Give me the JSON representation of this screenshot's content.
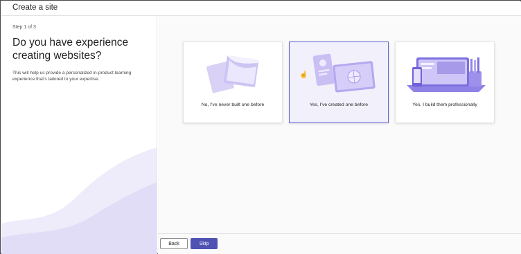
{
  "window": {
    "title": "Create a site"
  },
  "left": {
    "step": "Step 1 of 3",
    "heading": "Do you have experience creating websites?",
    "description": "This will help us provide a personalized in-product learning experience that's tailored to your expertise."
  },
  "options": [
    {
      "label": "No, I've never built one before",
      "selected": false
    },
    {
      "label": "Yes, I've created one before",
      "selected": true
    },
    {
      "label": "Yes, I build them professionally",
      "selected": false
    }
  ],
  "footer": {
    "back_label": "Back",
    "skip_label": "Skip"
  },
  "colors": {
    "accent": "#4f52b2",
    "selected_bg": "#f2f1fb",
    "illustration": "#b7aef0"
  }
}
